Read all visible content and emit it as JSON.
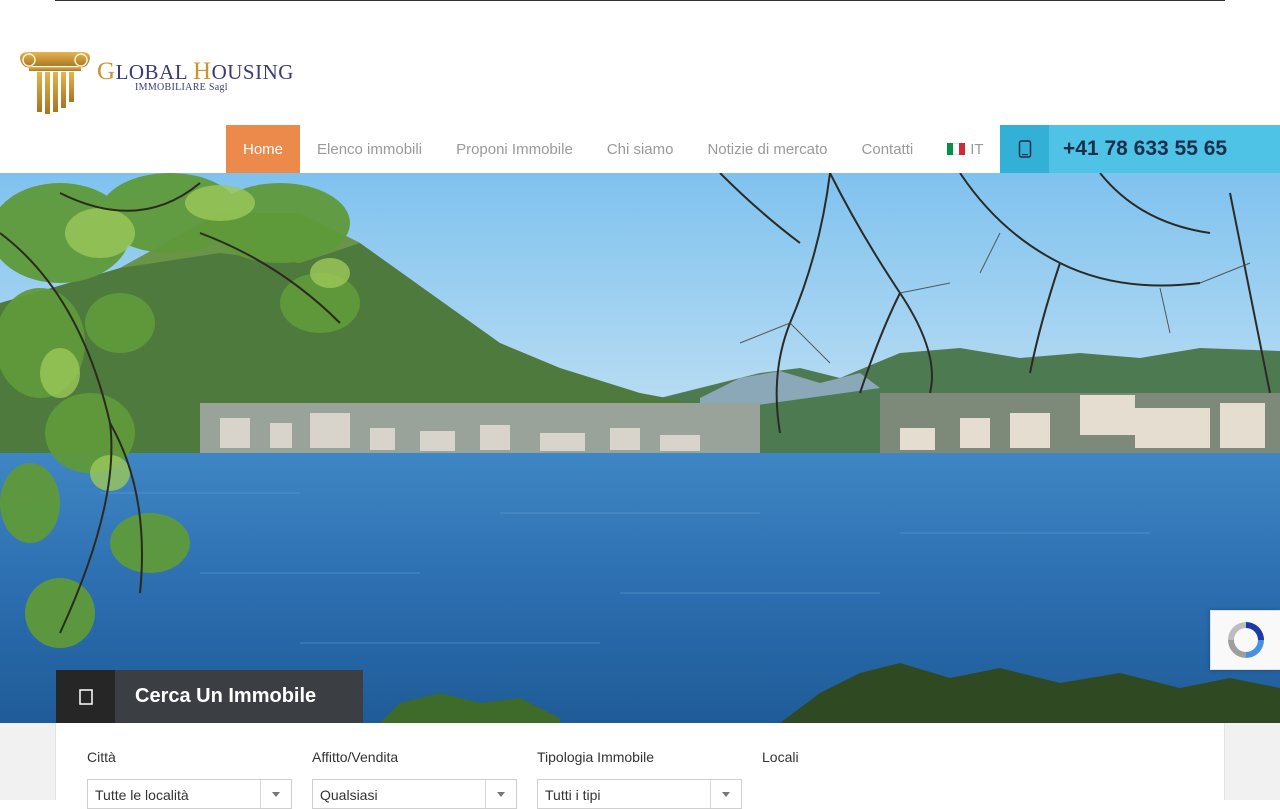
{
  "logo": {
    "name_first_cap": "G",
    "name_first_rest": "LOBAL ",
    "name_second_cap": "H",
    "name_second_rest": "OUSING",
    "subtitle": "IMMOBILIARE Sagl"
  },
  "nav": {
    "items": [
      {
        "label": "Home",
        "active": true
      },
      {
        "label": "Elenco immobili",
        "active": false
      },
      {
        "label": "Proponi Immobile",
        "active": false
      },
      {
        "label": "Chi siamo",
        "active": false
      },
      {
        "label": "Notizie di mercato",
        "active": false
      },
      {
        "label": "Contatti",
        "active": false
      }
    ],
    "language": "IT",
    "language_flag_icon": "italy-flag-icon"
  },
  "contact": {
    "phone": "+41 78 633 55 65",
    "phone_icon": "phone-icon"
  },
  "hero": {
    "image": "lake-lugano-landscape"
  },
  "search": {
    "tab_label": "Cerca Un Immobile",
    "tab_icon": "search-icon",
    "fields": [
      {
        "label": "Città",
        "value": "Tutte le località"
      },
      {
        "label": "Affitto/Vendita",
        "value": "Qualsiasi"
      },
      {
        "label": "Tipologia Immobile",
        "value": "Tutti i tipi"
      },
      {
        "label": "Locali",
        "value": ""
      }
    ]
  },
  "colors": {
    "accent_orange": "#ec8a4b",
    "phone_blue": "#4ec3e6",
    "logo_navy": "#3a3a78",
    "logo_gold": "#c8952e"
  }
}
